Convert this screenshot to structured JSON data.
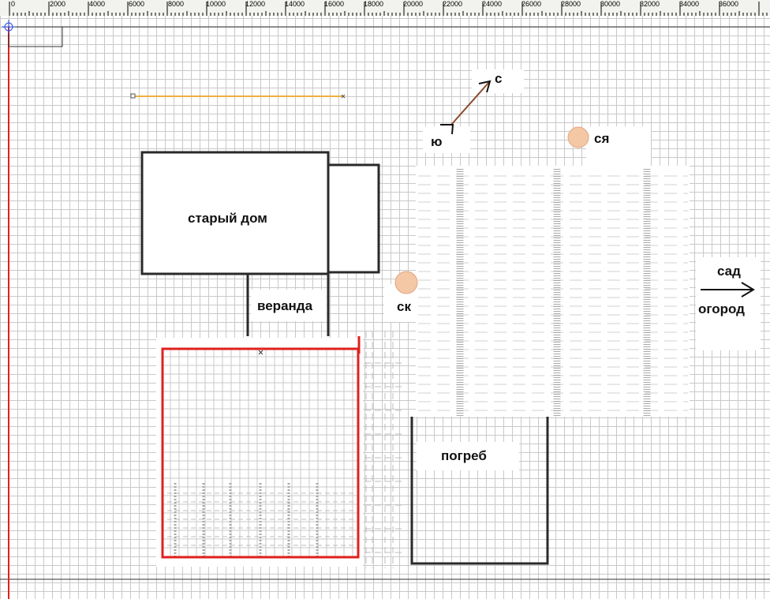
{
  "ruler": {
    "labels": [
      "0",
      "2000",
      "4000",
      "6000",
      "8000",
      "10000",
      "12000",
      "14000",
      "16000",
      "18000",
      "20000",
      "22000",
      "24000",
      "26000",
      "28000",
      "30000",
      "32000",
      "34000",
      "36000"
    ]
  },
  "labels": {
    "old_house": "старый дом",
    "veranda": "веранда",
    "compass_north": "с",
    "compass_south": "ю",
    "sk": "ск",
    "sya": "ся",
    "cellar": "погреб",
    "garden": "сад",
    "vegetable_garden": "огород"
  },
  "colors": {
    "outline": "#2a2a2a",
    "red": "#e0201c",
    "orange_line": "#f0b040",
    "circle_fill": "#f4c7a5",
    "circle_stroke": "#e0a684",
    "arrow": "#8b4a2b",
    "grid": "#c9c9c9"
  },
  "icons": {
    "compass_arrow": "arrow-up-right-icon",
    "direction_arrow": "arrow-right-icon"
  }
}
